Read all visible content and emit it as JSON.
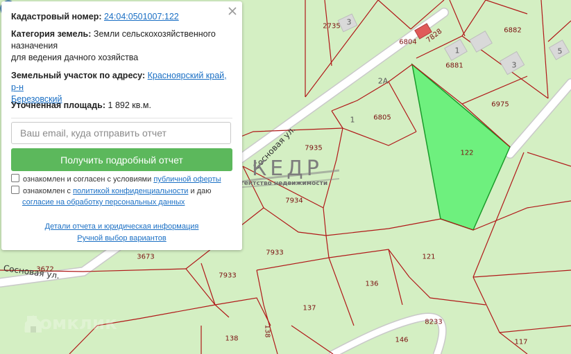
{
  "panel": {
    "cadastral_label": "Кадастровый номер:",
    "cadastral_number": "24:04:0501007:122",
    "category_label": "Категория земель:",
    "category_value_line1": "Земли сельскохозяйственного",
    "category_value_line2": "назначения",
    "category_value_line3": "для ведения дачного хозяйства",
    "address_label": "Земельный участок по адресу:",
    "address_value_line1": "Красноярский край, р-н",
    "address_value_line2": "Березовский",
    "area_label": "Уточненная площадь:",
    "area_value": "1 892 кв.м.",
    "email_placeholder": "Ваш email, куда отправить отчет",
    "report_button": "Получить подробный отчет",
    "consent1_text": "ознакомлен и согласен с условиями",
    "consent1_link": "публичной оферты",
    "consent2_text": "ознакомлен с",
    "consent2_link": "политикой конфиденциальности",
    "consent2_text2": "и даю",
    "consent2_link2": "согласие на обработку персональных данных",
    "details_link": "Детали отчета и юридическая информация",
    "manual_link": "Ручной выбор вариантов"
  },
  "map": {
    "plots": [
      "2735",
      "6804",
      "7828",
      "6882",
      "6881",
      "6975",
      "6805",
      "2A",
      "1",
      "7935",
      "7934",
      "7933",
      "7933",
      "3673",
      "3672",
      "122",
      "121",
      "136",
      "137",
      "138",
      "138",
      "146",
      "8233",
      "117"
    ],
    "buildings": [
      "3",
      "1",
      "3",
      "5"
    ],
    "streets": [
      "Сосновая ул.",
      "Сосновая ул."
    ],
    "selected_plot": "122",
    "colors": {
      "background": "#d4efc3",
      "boundary": "#b01818",
      "selected_fill": "#6ef07e",
      "pin": "#1f6fc3",
      "button": "#5cb85c",
      "link": "#1a6fc4"
    }
  },
  "watermark": {
    "title": "КЕДР",
    "subtitle": "агентство недвижимости"
  },
  "brand": "Домклик"
}
